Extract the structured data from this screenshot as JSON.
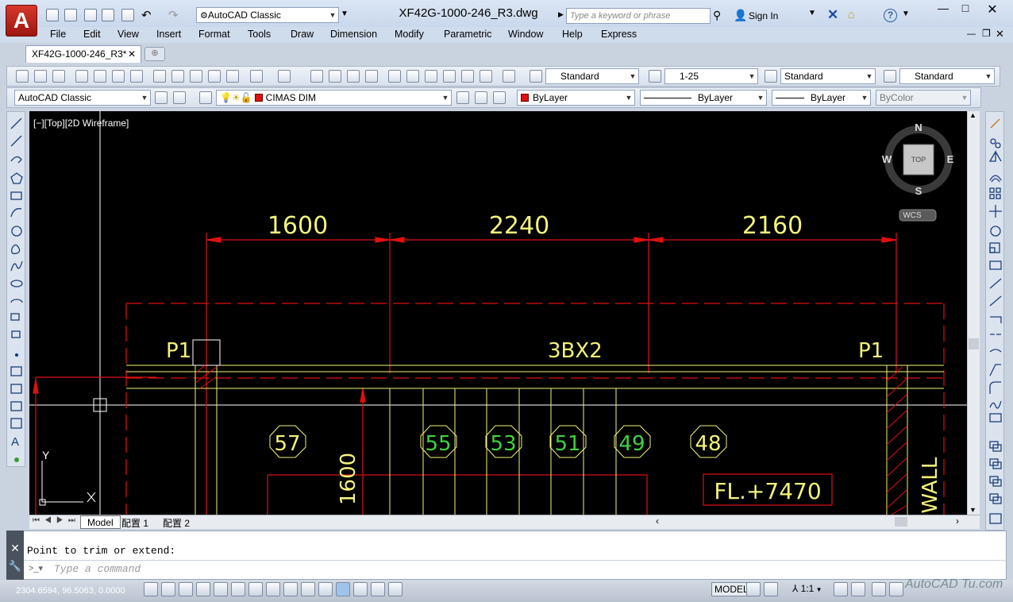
{
  "app": {
    "logo_letter": "A",
    "workspace": "AutoCAD Classic",
    "doc_title": "XF42G-1000-246_R3.dwg",
    "search_placeholder": "Type a keyword or phrase",
    "signin": "Sign In",
    "help": "?"
  },
  "menu": [
    "File",
    "Edit",
    "View",
    "Insert",
    "Format",
    "Tools",
    "Draw",
    "Dimension",
    "Modify",
    "Parametric",
    "Window",
    "Help",
    "Express"
  ],
  "doc_tab": "XF42G-1000-246_R3*",
  "styles": {
    "text_style": "Standard",
    "dim_style": "1-25",
    "table_style": "Standard",
    "mleader_style": "Standard"
  },
  "toolbar2": {
    "workspace": "AutoCAD Classic",
    "layer": "CIMAS DIM",
    "color": "ByLayer",
    "linetype": "ByLayer",
    "lineweight": "ByLayer",
    "plotstyle": "ByColor"
  },
  "viewport": {
    "label": "[−][Top][2D Wireframe]",
    "viewcube": {
      "N": "N",
      "S": "S",
      "E": "E",
      "W": "W",
      "top": "TOP",
      "wcs": "WCS"
    },
    "ucs_y": "Y",
    "ucs_x": "X"
  },
  "drawing": {
    "dims": [
      "1600",
      "2240",
      "2160"
    ],
    "p_left": "P1",
    "p_right": "P1",
    "beam": "3BX2",
    "tags": [
      "57",
      "55",
      "53",
      "51",
      "49",
      "48"
    ],
    "vdim": "1600",
    "fl": "FL.+7470",
    "wall": "K WALL"
  },
  "layout_tabs": [
    "Model",
    "配置 1",
    "配置 2"
  ],
  "command": {
    "history": "Point to trim or extend:",
    "placeholder": "Type a command"
  },
  "status": {
    "coords": "2304.6594, 96.5063, 0.0000",
    "model": "MODEL",
    "scale": "1:1"
  },
  "watermark": "AutoCAD Tu.com",
  "colors": {
    "canvas": "#000000",
    "dim": "#e01010",
    "yellow": "#f3f37a",
    "green": "#3fd23f",
    "white": "#ffffff"
  }
}
